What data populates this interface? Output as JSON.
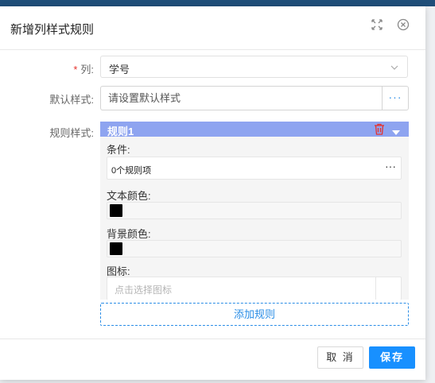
{
  "dialog": {
    "title": "新增列样式规则",
    "icons": {
      "fullscreen": "expand-icon",
      "close": "close-circle-icon"
    }
  },
  "form": {
    "column": {
      "required_mark": "*",
      "label": "列:",
      "value": "学号"
    },
    "default_style": {
      "label": "默认样式:",
      "placeholder": "请设置默认样式",
      "more": "···"
    },
    "rule_style": {
      "label": "规则样式:"
    }
  },
  "rule": {
    "title": "规则1",
    "condition_label": "条件:",
    "condition_value": "0个规则项",
    "condition_more": "···",
    "text_color_label": "文本颜色:",
    "text_color": "#000000",
    "bg_color_label": "背景颜色:",
    "bg_color": "#000000",
    "icon_label": "图标:",
    "icon_placeholder": "点击选择图标"
  },
  "add_rule_label": "添加规则",
  "footer": {
    "cancel": "取 消",
    "save": "保存"
  },
  "colors": {
    "accent": "#1890ff",
    "rule_header": "#8ea4f0",
    "delete": "#e5322d"
  }
}
